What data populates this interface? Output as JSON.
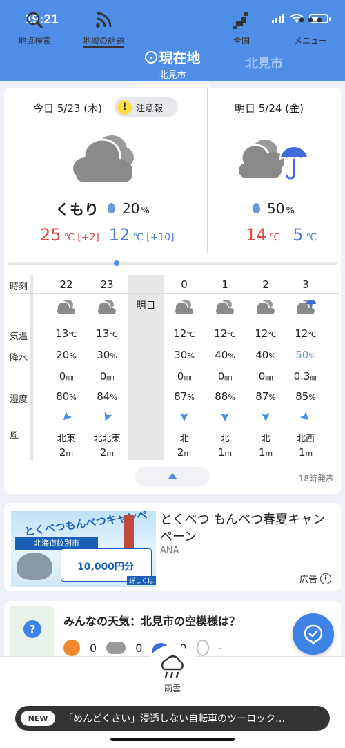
{
  "status_bar": {
    "time": "19:21"
  },
  "header": {
    "tab_current": "現在地",
    "tab_current_city": "北見市",
    "tab_other": "北見市"
  },
  "today": {
    "date": "今日 5/23 (木)",
    "warning": "注意報",
    "condition": "くもり",
    "pop": "20",
    "pop_unit": "%",
    "high": "25",
    "high_diff": "[+2]",
    "low": "12",
    "low_diff": "[+10]",
    "icon": "cloud-icon"
  },
  "tomorrow": {
    "date": "明日 5/24 (金)",
    "pop": "50",
    "pop_unit": "%",
    "high": "14",
    "low": "5",
    "icon": "cloud-umbrella-icon"
  },
  "units": {
    "celsius": "℃",
    "mm": "㎜",
    "meter": "m",
    "percent": "%"
  },
  "hourly": {
    "labels": {
      "time": "時刻",
      "temp": "気温",
      "precip_prob": "降水",
      "humidity": "湿度",
      "wind": "風"
    },
    "tomorrow_marker": "明日",
    "hours": [
      {
        "hour": "22",
        "temp": "13",
        "pop": "20",
        "rain": "0",
        "humidity": "80",
        "wind_dir": "北東",
        "wind_speed": "2"
      },
      {
        "hour": "23",
        "temp": "13",
        "pop": "30",
        "rain": "0",
        "humidity": "84",
        "wind_dir": "北北東",
        "wind_speed": "2"
      },
      {
        "hour": "0",
        "temp": "12",
        "pop": "30",
        "rain": "0",
        "humidity": "87",
        "wind_dir": "北",
        "wind_speed": "2"
      },
      {
        "hour": "1",
        "temp": "12",
        "pop": "40",
        "rain": "0",
        "humidity": "88",
        "wind_dir": "北",
        "wind_speed": "1"
      },
      {
        "hour": "2",
        "temp": "12",
        "pop": "40",
        "rain": "0",
        "humidity": "87",
        "wind_dir": "北",
        "wind_speed": "1"
      },
      {
        "hour": "3",
        "temp": "12",
        "pop": "50",
        "rain": "0.3",
        "humidity": "85",
        "wind_dir": "北西",
        "wind_speed": "1"
      }
    ],
    "published": "18時発表"
  },
  "ad": {
    "title": "とくべつ もんべつ春夏キャンペーン",
    "brand": "ANA",
    "label": "広告",
    "image_heading": "とくべつもんべつキャンペーン",
    "image_sub": "北海道紋別市",
    "image_amount": "10,000円分",
    "image_more": "詳しくは"
  },
  "community": {
    "title": "みんなの天気：北見市の空模様は？",
    "counts": [
      "0",
      "0",
      "0",
      "-"
    ]
  },
  "nav": {
    "items": [
      "地点検索",
      "地域の話題",
      "雨雲",
      "全国",
      "メニュー"
    ]
  },
  "news": {
    "tag": "NEW",
    "text": "「めんどくさい」浸透しない自転車のツーロック…"
  }
}
